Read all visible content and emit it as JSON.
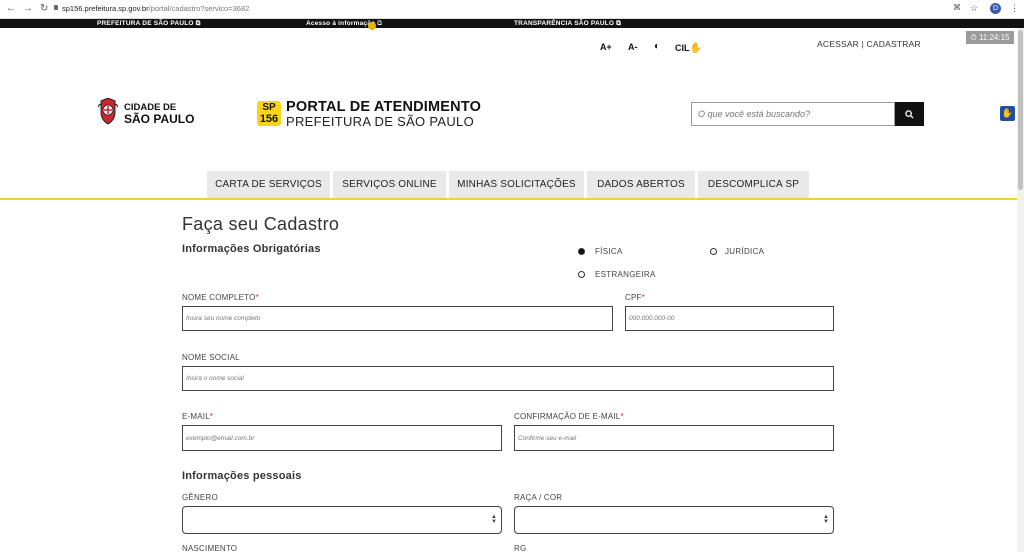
{
  "browser": {
    "url_host": "sp156.prefeitura.sp.gov.br",
    "url_path": "/portal/cadastro?servico=3682",
    "profile_initial": "D"
  },
  "gov_bar": {
    "prefeitura": "PREFEITURA DE SÃO PAULO",
    "acesso": "Acesso à informação",
    "transparencia": "TRANSPARÊNCIA SÃO PAULO"
  },
  "clock": "11:24:15",
  "accessibility": {
    "increase": "A+",
    "decrease": "A-",
    "contrast": "◐",
    "cil": "CIL"
  },
  "auth": "ACESSAR | CADASTRAR",
  "header": {
    "cidade_line1": "CIDADE DE",
    "cidade_line2": "SÃO PAULO",
    "sp": "SP",
    "n156": "156",
    "portal_title": "PORTAL DE ATENDIMENTO",
    "portal_subtitle": "PREFEITURA DE SÃO PAULO",
    "search_placeholder": "O que você está buscando?"
  },
  "menu": [
    "CARTA DE SERVIÇOS",
    "SERVIÇOS ONLINE",
    "MINHAS SOLICITAÇÕES",
    "DADOS ABERTOS",
    "DESCOMPLICA SP"
  ],
  "form": {
    "title": "Faça seu Cadastro",
    "required_section": "Informações Obrigatórias",
    "person_types": {
      "fisica": "FÍSICA",
      "juridica": "JURÍDICA",
      "estrangeira": "ESTRANGEIRA",
      "selected": "FÍSICA"
    },
    "nome_label": "NOME COMPLETO",
    "nome_placeholder": "Insira seu nome completo",
    "cpf_label": "CPF",
    "cpf_placeholder": "000.000.000-00",
    "nome_social_label": "NOME SOCIAL",
    "nome_social_placeholder": "Insira o nome social",
    "email_label": "E-MAIL",
    "email_placeholder": "exemplo@email.com.br",
    "email_conf_label": "CONFIRMAÇÃO DE E-MAIL",
    "email_conf_placeholder": "Confirme seu e-mail",
    "personal_section": "Informações pessoais",
    "genero_label": "GÊNERO",
    "raca_label": "RAÇA / COR",
    "nascimento_label": "NASCIMENTO",
    "rg_label": "RG",
    "required_mark": "*"
  },
  "colors": {
    "accent_yellow": "#f2d22e",
    "required_red": "#d62424",
    "dark": "#111111"
  }
}
